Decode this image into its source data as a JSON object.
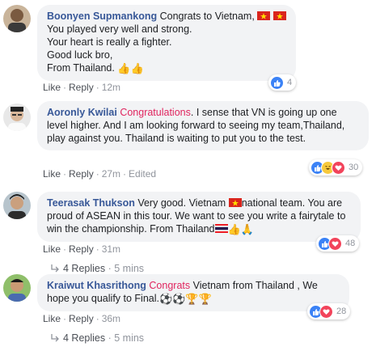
{
  "colors": {
    "author": "#385898",
    "highlight": "#e0245e",
    "bubble_bg": "#f2f3f5",
    "meta": "#90949c",
    "like_blue": "#3b82f6",
    "love_red": "#f2445b"
  },
  "comments": [
    {
      "author": "Boonyen Supmankong",
      "lines": [
        "Congrats to Vietnam,",
        "You played very well and strong.",
        "Your heart is really a fighter.",
        "Good luck bro,",
        "From Thailand."
      ],
      "like_label": "Like",
      "reply_label": "Reply",
      "time": "12m",
      "reaction_count": "4",
      "reactions": [
        "like-icon"
      ]
    },
    {
      "author": "Aoronly Kwilai",
      "highlight": "Congratulations",
      "text": ". I sense that VN is going up one level higher. And I am looking forward to seeing my team,Thailand, play against you. Thailand is waiting to put you to the test.",
      "like_label": "Like",
      "reply_label": "Reply",
      "time": "27m",
      "edited": "Edited",
      "reaction_count": "30",
      "reactions": [
        "like-icon",
        "haha-icon",
        "love-icon"
      ]
    },
    {
      "author": "Teerasak Thukson",
      "text_a": "Very good. Vietnam",
      "text_b": "national team. You are proud of ASEAN in this tour. We want to see you write a fairytale to win the championship. From Thailand",
      "like_label": "Like",
      "reply_label": "Reply",
      "time": "31m",
      "reaction_count": "48",
      "reactions": [
        "like-icon",
        "love-icon"
      ],
      "replies_label": "4 Replies",
      "replies_time": "5 mins"
    },
    {
      "author": "Kraiwut Khasrithong",
      "highlight": "Congrats",
      "text": "Vietnam from Thailand , We hope you qualify to Final.",
      "like_label": "Like",
      "reply_label": "Reply",
      "time": "36m",
      "reaction_count": "28",
      "reactions": [
        "like-icon",
        "love-icon"
      ],
      "replies_label": "4 Replies",
      "replies_time": "5 mins"
    }
  ]
}
